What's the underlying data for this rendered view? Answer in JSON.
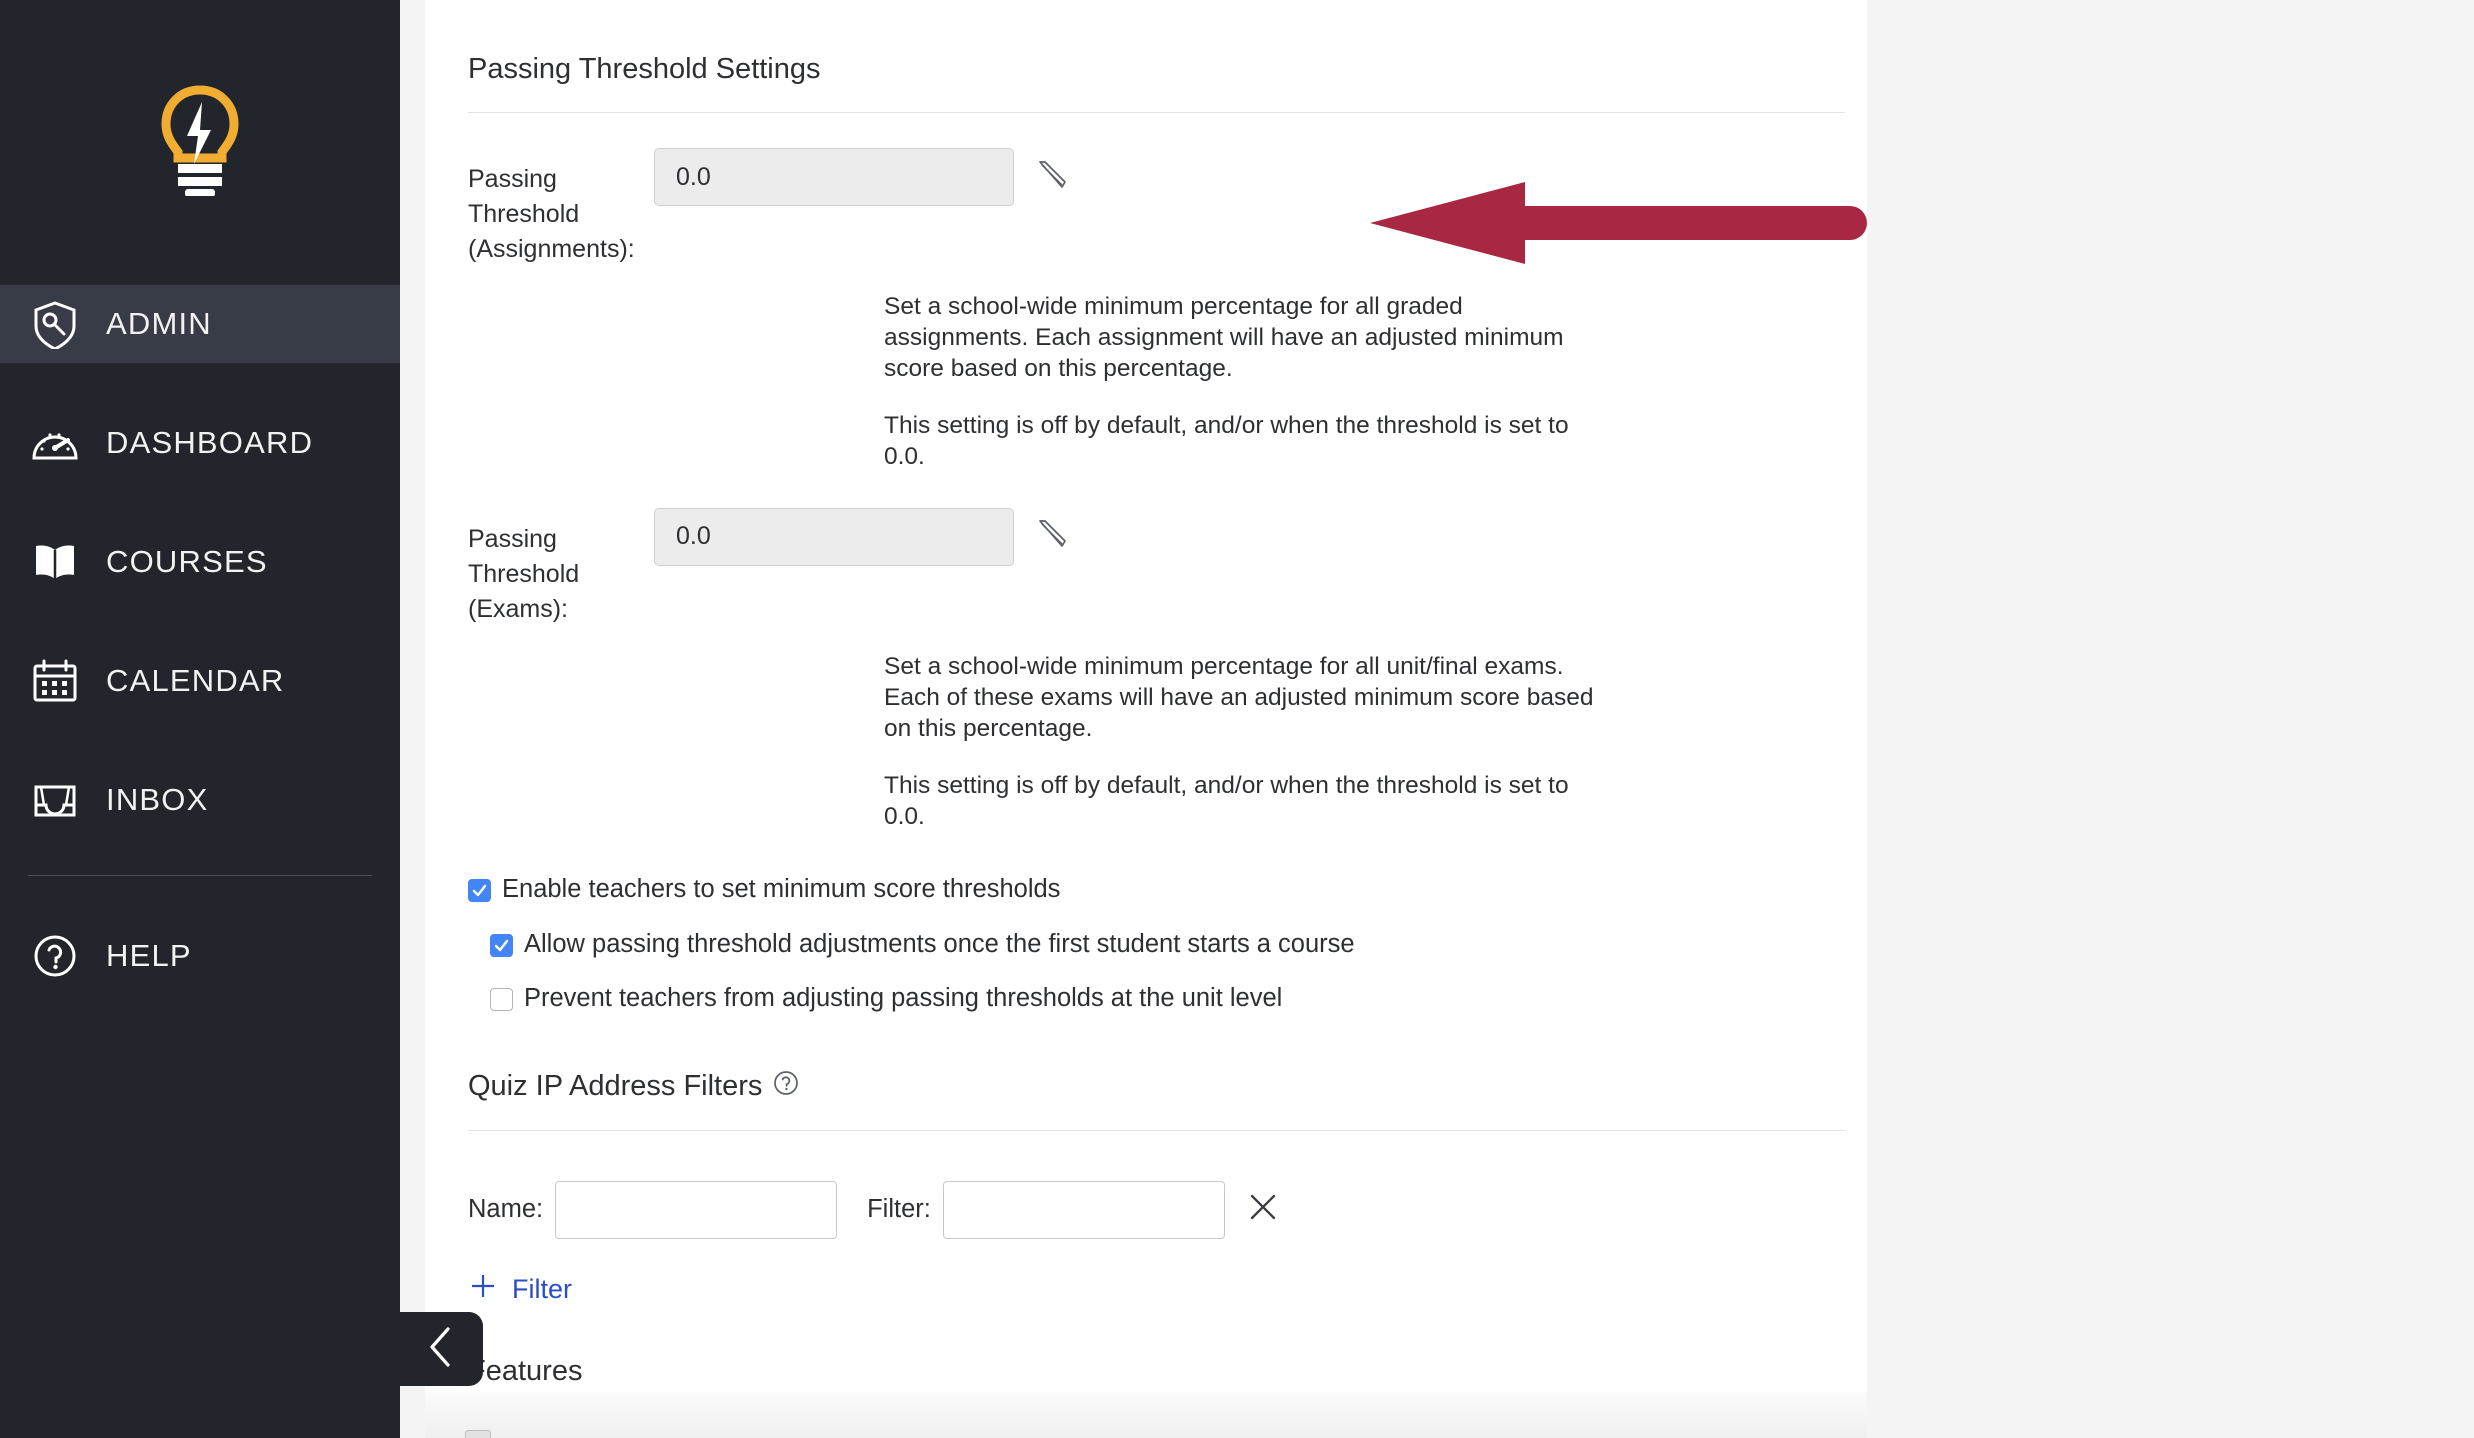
{
  "brand": {
    "logo_icon": "lightbulb-lightning-icon",
    "logo_bulb_color": "#f0ad32",
    "sidebar_bg": "#22252b",
    "active_bg": "#383c46"
  },
  "sidebar": {
    "items": [
      {
        "label": "ADMIN",
        "icon": "shield-key-icon",
        "active": true
      },
      {
        "label": "DASHBOARD",
        "icon": "gauge-icon",
        "active": false
      },
      {
        "label": "COURSES",
        "icon": "open-book-icon",
        "active": false
      },
      {
        "label": "CALENDAR",
        "icon": "calendar-icon",
        "active": false
      },
      {
        "label": "INBOX",
        "icon": "inbox-tray-icon",
        "active": false
      },
      {
        "label": "HELP",
        "icon": "question-circle-icon",
        "active": false
      }
    ]
  },
  "collapse": {
    "icon": "chevron-left-icon"
  },
  "main": {
    "section_title": "Passing Threshold Settings",
    "fields": [
      {
        "label": "Passing Threshold (Assignments):",
        "label_line1": "Passing Threshold",
        "label_line2": "(Assignments):",
        "value": "0.0",
        "edit_icon": "pencil-icon",
        "desc1": "Set a school-wide minimum percentage for all graded assignments. Each assignment will have an adjusted minimum score based on this percentage.",
        "desc2": "This setting is off by default, and/or when the threshold is set to 0.0."
      },
      {
        "label": "Passing Threshold (Exams):",
        "label_line1": "Passing Threshold",
        "label_line2": "(Exams):",
        "value": "0.0",
        "edit_icon": "pencil-icon",
        "desc1": "Set a school-wide minimum percentage for all unit/final exams. Each of these exams will have an adjusted minimum score based on this percentage.",
        "desc2": "This setting is off by default, and/or when the threshold is set to 0.0."
      }
    ],
    "checkboxes": [
      {
        "label": "Enable teachers to set minimum score thresholds",
        "checked": true,
        "indent": false
      },
      {
        "label": "Allow passing threshold adjustments once the first student starts a course",
        "checked": true,
        "indent": true
      },
      {
        "label": "Prevent teachers from adjusting passing thresholds at the unit level",
        "checked": false,
        "indent": true
      }
    ],
    "quiz_ip": {
      "title": "Quiz IP Address Filters",
      "help_icon": "question-circle-icon",
      "name_label": "Name:",
      "name_value": "",
      "name_placeholder": "",
      "filter_label": "Filter:",
      "filter_value": "",
      "filter_placeholder": "",
      "remove_icon": "close-x-icon",
      "add_label": "Filter",
      "add_icon": "plus-icon"
    },
    "features_title": "Features"
  },
  "colors": {
    "accent_link": "#2a4fc4",
    "checkbox_on": "#4285f4",
    "annotation_arrow": "#a82843",
    "panel_bg": "#ffffff",
    "page_bg": "#f4f4f4"
  },
  "annotation": {
    "shape": "left-pointing-arrow",
    "color": "#a82843"
  }
}
